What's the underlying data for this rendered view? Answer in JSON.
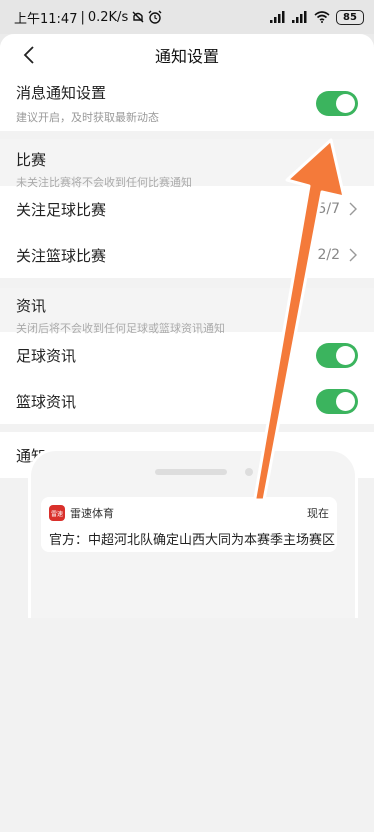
{
  "status_bar": {
    "time": "上午11:47",
    "network_speed": "0.2K/s",
    "battery": "85",
    "icons": [
      "mute-icon",
      "alarm-icon",
      "signal-icon",
      "signal-icon",
      "wifi-icon",
      "battery-icon"
    ]
  },
  "nav": {
    "title": "通知设置",
    "back_icon": "chevron-left-icon"
  },
  "push": {
    "title": "消息通知设置",
    "subtitle": "建议开启，及时获取最新动态",
    "enabled": true
  },
  "match_group": {
    "title": "比赛",
    "subtitle": "未关注比赛将不会收到任何比赛通知"
  },
  "match_rows": [
    {
      "label": "关注足球比赛",
      "count": "5/7"
    },
    {
      "label": "关注篮球比赛",
      "count": "2/2"
    }
  ],
  "news_group": {
    "title": "资讯",
    "subtitle": "关闭后将不会收到任何足球或篮球资讯通知"
  },
  "news_rows": [
    {
      "label": "足球资讯",
      "enabled": true
    },
    {
      "label": "篮球资讯",
      "enabled": true
    }
  ],
  "example": {
    "title": "通知示例",
    "notification": {
      "app_icon_text": "雷速",
      "app_name": "雷速体育",
      "time": "现在",
      "body": "官方：中超河北队确定山西大同为本赛季主场赛区"
    }
  },
  "colors": {
    "toggle_on": "#3bb45e",
    "annotation_arrow": "#f47a3a",
    "app_icon": "#d9302b"
  }
}
